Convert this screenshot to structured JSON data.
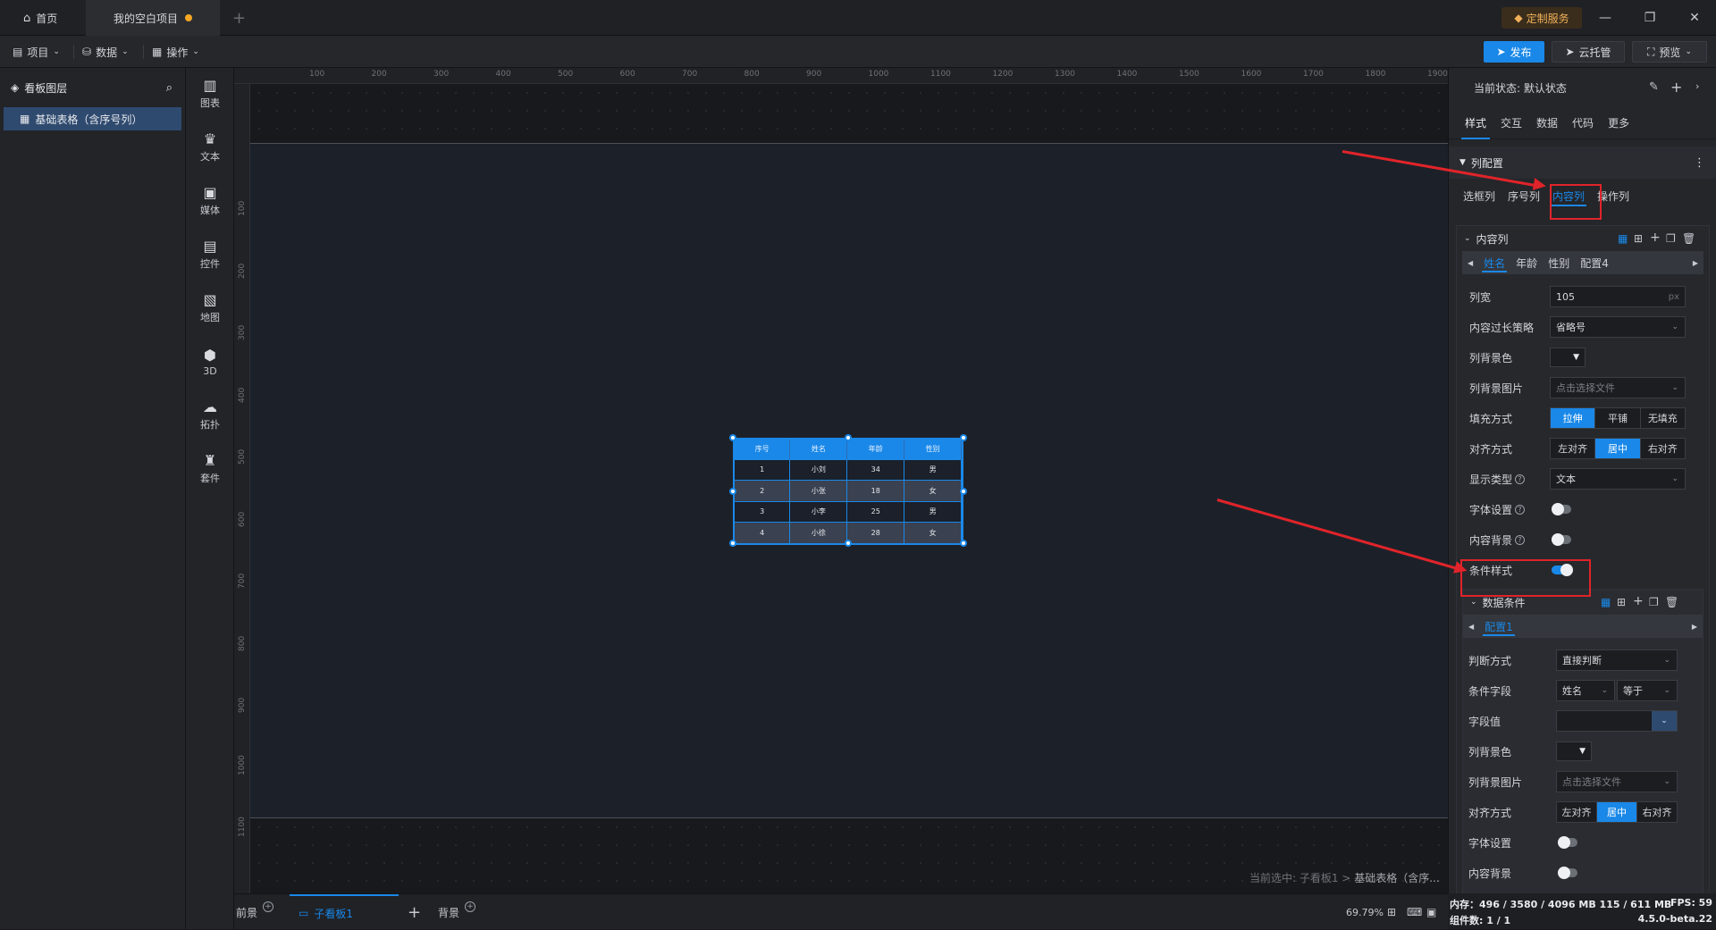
{
  "titlebar": {
    "home_tab": "首页",
    "project_tab": "我的空白项目",
    "custom_service": "定制服务"
  },
  "toolbar": {
    "project": "项目",
    "data": "数据",
    "operate": "操作",
    "publish": "发布",
    "cloud": "云托管",
    "preview": "预览"
  },
  "layers": {
    "title": "看板图层",
    "items": [
      "基础表格（含序号列）"
    ]
  },
  "components": [
    {
      "label": "图表",
      "icon": "chart-icon"
    },
    {
      "label": "文本",
      "icon": "text-icon"
    },
    {
      "label": "媒体",
      "icon": "media-icon"
    },
    {
      "label": "控件",
      "icon": "control-icon"
    },
    {
      "label": "地图",
      "icon": "map-icon"
    },
    {
      "label": "3D",
      "icon": "cube-icon"
    },
    {
      "label": "拓扑",
      "icon": "topology-icon"
    },
    {
      "label": "套件",
      "icon": "kit-icon"
    }
  ],
  "ruler": {
    "top": [
      "100",
      "200",
      "300",
      "400",
      "500",
      "600",
      "700",
      "800",
      "900",
      "1000",
      "1100",
      "1200",
      "1300",
      "1400",
      "1500",
      "1600",
      "1700",
      "1800",
      "1900"
    ],
    "left": [
      "100",
      "200",
      "300",
      "400",
      "500",
      "600",
      "700",
      "800",
      "900",
      "1000",
      "1100"
    ]
  },
  "table": {
    "headers": [
      "序号",
      "姓名",
      "年龄",
      "性别"
    ],
    "rows": [
      [
        "1",
        "小刘",
        "34",
        "男"
      ],
      [
        "2",
        "小张",
        "18",
        "女"
      ],
      [
        "3",
        "小李",
        "25",
        "男"
      ],
      [
        "4",
        "小徐",
        "28",
        "女"
      ]
    ]
  },
  "canvas": {
    "current_selection_prefix": "当前选中: 子看板1 > ",
    "current_selection_target": "基础表格（含序..."
  },
  "bottom": {
    "foreground": "前景",
    "sub_board": "子看板1",
    "background": "背景",
    "zoom": "69.79%"
  },
  "right": {
    "state_label": "当前状态:  默认状态",
    "tabs": [
      "样式",
      "交互",
      "数据",
      "代码",
      "更多"
    ],
    "section": "列配置",
    "col_tabs": [
      "选框列",
      "序号列",
      "内容列",
      "操作列"
    ],
    "content_col": {
      "title": "内容列",
      "fields": [
        "姓名",
        "年龄",
        "性别",
        "配置4"
      ],
      "width_label": "列宽",
      "width_value": "105",
      "width_unit": "px",
      "overflow_label": "内容过长策略",
      "overflow_value": "省略号",
      "bg_color_label": "列背景色",
      "bg_image_label": "列背景图片",
      "bg_image_placeholder": "点击选择文件",
      "fill_label": "填充方式",
      "fill_options": [
        "拉伸",
        "平铺",
        "无填充"
      ],
      "align_label": "对齐方式",
      "align_options": [
        "左对齐",
        "居中",
        "右对齐"
      ],
      "display_label": "显示类型",
      "display_value": "文本",
      "font_label": "字体设置",
      "content_bg_label": "内容背景",
      "cond_label": "条件样式"
    },
    "data_cond": {
      "title": "数据条件",
      "config_tab": "配置1",
      "judge_label": "判断方式",
      "judge_value": "直接判断",
      "field_label": "条件字段",
      "field_value": "姓名",
      "op_value": "等于",
      "value_label": "字段值",
      "bg_color_label": "列背景色",
      "bg_image_label": "列背景图片",
      "bg_image_placeholder": "点击选择文件",
      "align_label": "对齐方式",
      "align_options": [
        "左对齐",
        "居中",
        "右对齐"
      ],
      "font_label": "字体设置",
      "content_bg_label": "内容背景"
    }
  },
  "status": {
    "memory": "内存：496 / 3580 / 4096 MB  115 / 611 MB",
    "fps": "FPS:  59",
    "components": "组件数: 1 / 1",
    "version": "4.5.0-beta.22"
  },
  "colors": {
    "accent": "#1a88e8",
    "annotation": "#e0242a"
  }
}
